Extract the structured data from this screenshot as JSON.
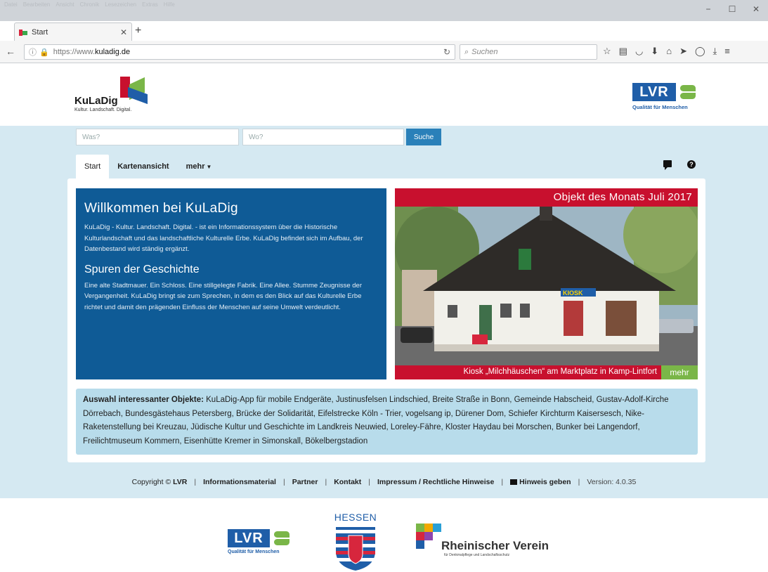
{
  "browser": {
    "menu": [
      "Datei",
      "Bearbeiten",
      "Ansicht",
      "Chronik",
      "Lesezeichen",
      "Extras",
      "Hilfe"
    ],
    "tab_title": "Start",
    "url_proto": "https://www.",
    "url_host": "kuladig.de",
    "search_placeholder": "Suchen"
  },
  "header": {
    "logo_name": "KuLaDig",
    "logo_tagline": "Kultur. Landschaft. Digital.",
    "lvr_text": "LVR",
    "lvr_tagline": "Qualität für Menschen"
  },
  "search": {
    "what_placeholder": "Was?",
    "where_placeholder": "Wo?",
    "button": "Suche"
  },
  "nav": {
    "tabs": [
      "Start",
      "Kartenansicht",
      "mehr"
    ]
  },
  "welcome": {
    "title": "Willkommen bei KuLaDig",
    "intro": "KuLaDig - Kultur. Landschaft. Digital. - ist ein Informationssystem über die Historische Kulturlandschaft und das landschaftliche Kulturelle Erbe. KuLaDig befindet sich im Aufbau, der Datenbestand wird ständig ergänzt.",
    "subtitle": "Spuren der Geschichte",
    "body": "Eine alte Stadtmauer. Ein Schloss. Eine stillgelegte Fabrik. Eine Allee. Stumme Zeugnisse der Vergangenheit. KuLaDig bringt sie zum Sprechen, in dem es den Blick auf das Kulturelle Erbe richtet und damit den prägenden Einfluss der Menschen auf seine Umwelt verdeutlicht."
  },
  "object_of_month": {
    "heading": "Objekt des Monats Juli 2017",
    "caption": "Kiosk „Milchhäuschen“ am Marktplatz in Kamp-Lintfort",
    "more": "mehr",
    "sign_text": "KIOSK"
  },
  "objects": {
    "lead": "Auswahl interessanter Objekte:",
    "list": "KuLaDig-App für mobile Endgeräte, Justinusfelsen Lindschied, Breite Straße in Bonn, Gemeinde Habscheid, Gustav-Adolf-Kirche Dörrebach, Bundesgästehaus Petersberg, Brücke der Solidarität, Eifelstrecke Köln - Trier, vogelsang ip, Dürener Dom, Schiefer Kirchturm Kaisersesch, Nike-Raketenstellung bei Kreuzau, Jüdische Kultur und Geschichte im Landkreis Neuwied, Loreley-Fähre, Kloster Haydau bei Morschen, Bunker bei Langendorf, Freilichtmuseum Kommern, Eisenhütte Kremer in Simonskall, Bökelbergstadion"
  },
  "footer": {
    "copyright": "Copyright ©",
    "copyright_owner": "LVR",
    "info": "Informationsmaterial",
    "partner": "Partner",
    "contact": "Kontakt",
    "imprint": "Impressum / Rechtliche Hinweise",
    "feedback": "Hinweis geben",
    "version": "Version: 4.0.35"
  },
  "partners": {
    "lvr_text": "LVR",
    "lvr_tagline": "Qualität für Menschen",
    "hessen": "HESSEN",
    "rv_name": "Rheinischer Verein",
    "rv_sub": "für Denkmalpflege und Landschaftsschutz"
  },
  "colors": {
    "brand_blue": "#0f5b96",
    "brand_red": "#c8102e",
    "brand_green": "#7ab648",
    "band": "#d5e9f2"
  }
}
